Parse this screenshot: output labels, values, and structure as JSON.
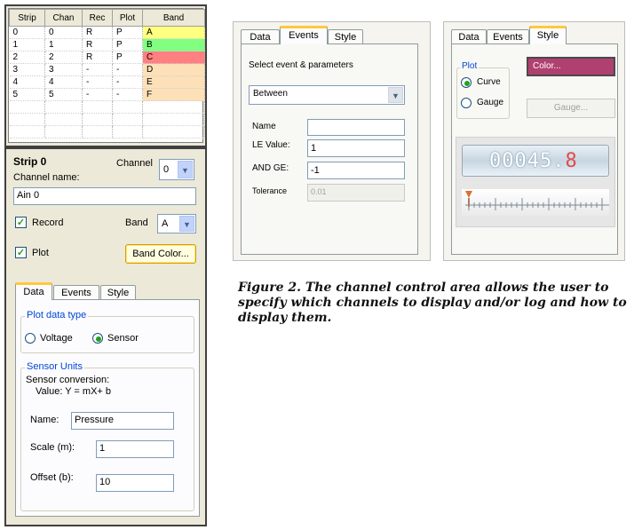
{
  "table": {
    "headers": [
      "Strip",
      "Chan",
      "Rec",
      "Plot",
      "Band"
    ],
    "rows": [
      {
        "strip": "0",
        "chan": "0",
        "rec": "R",
        "plot": "P",
        "band": "A",
        "color": "#ffff80"
      },
      {
        "strip": "1",
        "chan": "1",
        "rec": "R",
        "plot": "P",
        "band": "B",
        "color": "#80ff80"
      },
      {
        "strip": "2",
        "chan": "2",
        "rec": "R",
        "plot": "P",
        "band": "C",
        "color": "#ff8080"
      },
      {
        "strip": "3",
        "chan": "3",
        "rec": "-",
        "plot": "-",
        "band": "D",
        "color": "#fde0b8"
      },
      {
        "strip": "4",
        "chan": "4",
        "rec": "-",
        "plot": "-",
        "band": "E",
        "color": "#fde0b8"
      },
      {
        "strip": "5",
        "chan": "5",
        "rec": "-",
        "plot": "-",
        "band": "F",
        "color": "#fde0b8"
      }
    ]
  },
  "strip": {
    "title": "Strip 0",
    "channel_label": "Channel",
    "channel_value": "0",
    "channel_name_label": "Channel name:",
    "channel_name_value": "Ain 0",
    "record_label": "Record",
    "record_checked": "✓",
    "band_label": "Band",
    "band_value": "A",
    "plot_label": "Plot",
    "plot_checked": "✓",
    "band_color_button": "Band Color..."
  },
  "tabs": {
    "data": "Data",
    "events": "Events",
    "style": "Style"
  },
  "data_tab": {
    "plot_type_legend": "Plot data type",
    "voltage": "Voltage",
    "sensor": "Sensor",
    "sensor_units_legend": "Sensor Units",
    "conversion_line1": "Sensor conversion:",
    "conversion_line2": "Value:  Y = mX+ b",
    "name_label": "Name:",
    "name_value": "Pressure",
    "scale_label": "Scale (m):",
    "scale_value": "1",
    "offset_label": "Offset (b):",
    "offset_value": "10"
  },
  "events_tab": {
    "select_label": "Select event & parameters",
    "event_value": "Between",
    "name_label": "Name",
    "name_value": "",
    "le_label": "LE Value:",
    "le_value": "1",
    "and_ge_label": "AND GE:",
    "and_ge_value": "-1",
    "tolerance_label": "Tolerance",
    "tolerance_value": "0.01"
  },
  "style_tab": {
    "plot_legend": "Plot",
    "curve": "Curve",
    "gauge": "Gauge",
    "color_button": "Color...",
    "gauge_button": "Gauge...",
    "counter": "00045.8",
    "counter_main": "00045.",
    "counter_frac": "8"
  },
  "caption": "Figure 2.  The channel control area allows the user to specify which channels to display and/or log and how to display them.",
  "colors": {
    "color_button": "#b04070",
    "active_tab": "#ffc83c",
    "legend_text": "#0046d5"
  }
}
